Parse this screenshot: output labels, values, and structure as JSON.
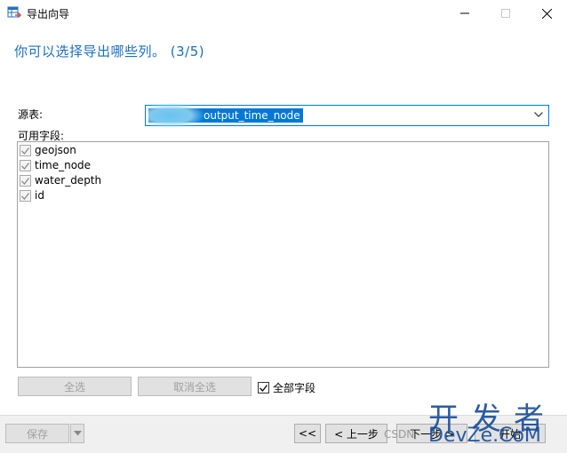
{
  "window": {
    "title": "导出向导"
  },
  "heading": "你可以选择导出哪些列。 (3/5)",
  "source": {
    "label": "源表:",
    "value": "output_time_node"
  },
  "fields": {
    "label": "可用字段:",
    "items": [
      {
        "name": "geojson",
        "checked": true
      },
      {
        "name": "time_node",
        "checked": true
      },
      {
        "name": "water_depth",
        "checked": true
      },
      {
        "name": "id",
        "checked": true
      }
    ]
  },
  "buttons": {
    "select_all": "全选",
    "deselect_all": "取消全选",
    "all_fields": "全部字段",
    "save": "保存",
    "first": "<<",
    "prev": "< 上一步",
    "next": "下一步 >",
    "finish": "开始"
  },
  "watermark": {
    "line1": "开发者",
    "line2": "DevZe.CoM",
    "csdn": "CSDN"
  },
  "colors": {
    "accent": "#0078d7",
    "heading": "#1a6fc2",
    "watermark": "#1a4f9c"
  }
}
